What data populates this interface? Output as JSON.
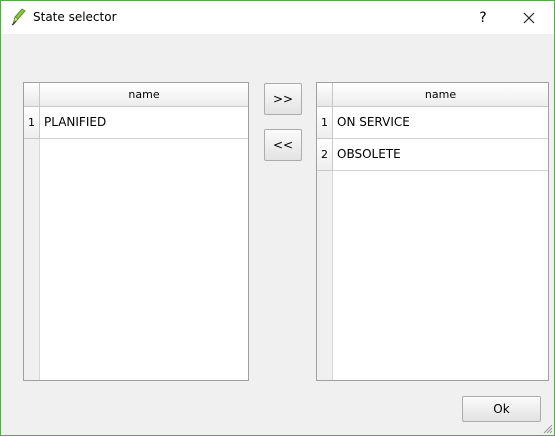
{
  "window": {
    "title": "State selector",
    "help_label": "?"
  },
  "left_list": {
    "column_header": "name",
    "rows": [
      {
        "index": "1",
        "value": "PLANIFIED"
      }
    ]
  },
  "right_list": {
    "column_header": "name",
    "rows": [
      {
        "index": "1",
        "value": "ON SERVICE"
      },
      {
        "index": "2",
        "value": "OBSOLETE"
      }
    ]
  },
  "buttons": {
    "move_right": ">>",
    "move_left": "<<",
    "ok": "Ok"
  },
  "icons": {
    "app": "qgis-pencil-icon",
    "close": "close-icon",
    "grip": "size-grip-icon"
  },
  "colors": {
    "window_border": "#5aa64e"
  }
}
